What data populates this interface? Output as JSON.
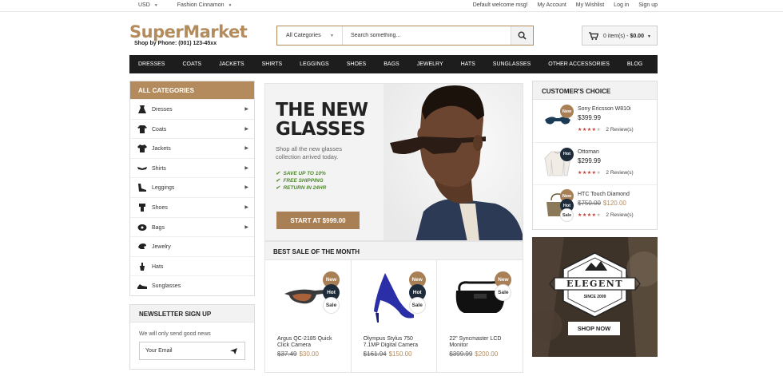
{
  "topbar": {
    "currency": "USD",
    "theme": "Fashion Cinnamon",
    "welcome": "Default welcome msg!",
    "links": [
      "My Account",
      "My Wishlist",
      "Log in",
      "Sign up"
    ]
  },
  "header": {
    "logo": "SuperMarket",
    "phone": "Shop by Phone: (001) 123-45xx",
    "search_category": "All Categories",
    "search_placeholder": "Search something...",
    "cart_items": "0 item(s) - ",
    "cart_total": "$0.00"
  },
  "nav": [
    "DRESSES",
    "COATS",
    "JACKETS",
    "SHIRTS",
    "LEGGINGS",
    "SHOES",
    "BAGS",
    "JEWELRY",
    "HATS",
    "SUNGLASSES",
    "OTHER ACCESSORIES",
    "BLOG"
  ],
  "categories": {
    "title": "ALL CATEGORIES",
    "items": [
      {
        "label": "Dresses",
        "icon": "dress-icon",
        "arrow": true
      },
      {
        "label": "Coats",
        "icon": "coat-icon",
        "arrow": true
      },
      {
        "label": "Jackets",
        "icon": "jacket-icon",
        "arrow": true
      },
      {
        "label": "Shirts",
        "icon": "shirt-icon",
        "arrow": true
      },
      {
        "label": "Leggings",
        "icon": "leggings-icon",
        "arrow": true
      },
      {
        "label": "Shoes",
        "icon": "shoe-icon",
        "arrow": true
      },
      {
        "label": "Bags",
        "icon": "bag-icon",
        "arrow": true
      },
      {
        "label": "Jewelry",
        "icon": "jewelry-icon",
        "arrow": false
      },
      {
        "label": "Hats",
        "icon": "hat-icon",
        "arrow": false
      },
      {
        "label": "Sunglasses",
        "icon": "sunglasses-icon",
        "arrow": false
      }
    ]
  },
  "newsletter": {
    "title": "NEWSLETTER SIGN UP",
    "subtitle": "We will only send good news",
    "placeholder": "Your Email"
  },
  "hero": {
    "title_line1": "THE NEW",
    "title_line2": "GLASSES",
    "description": "Shop all the new glasses collection arrived today.",
    "features": [
      "SAVE UP TO 10%",
      "FREE SHIPPING",
      "RETURN IN 24HR"
    ],
    "cta": "START AT $999.00"
  },
  "best_sale": {
    "title": "BEST SALE OF THE MONTH",
    "products": [
      {
        "name": "Argus QC-2185 Quick Click Camera",
        "old_price": "$37.49",
        "price": "$30.00",
        "badges": [
          "New",
          "Hot",
          "Sale"
        ]
      },
      {
        "name": "Olympus Stylus 750 7.1MP Digital Camera",
        "old_price": "$161.94",
        "price": "$150.00",
        "badges": [
          "New",
          "Hot",
          "Sale"
        ]
      },
      {
        "name": "22\" Syncmaster LCD Monitor",
        "old_price": "$399.99",
        "price": "$200.00",
        "badges": [
          "New",
          "Sale"
        ]
      }
    ]
  },
  "customers_choice": {
    "title": "CUSTOMER'S CHOICE",
    "items": [
      {
        "name": "Sony Ericsson W810i",
        "price": "$399.99",
        "old_price": "",
        "rating": 4,
        "reviews": "2 Review(s)",
        "badges": [
          "New"
        ]
      },
      {
        "name": "Ottoman",
        "price": "$299.99",
        "old_price": "",
        "rating": 4,
        "reviews": "2 Review(s)",
        "badges": [
          "Hot"
        ]
      },
      {
        "name": "HTC Touch Diamond",
        "price": "$120.00",
        "old_price": "$750.00",
        "rating": 4,
        "reviews": "2 Review(s)",
        "badges": [
          "New",
          "Hot",
          "Sale"
        ]
      }
    ]
  },
  "promo": {
    "brand": "ELEGENT",
    "since": "SINCE 2009",
    "cta": "SHOP NOW"
  },
  "colors": {
    "accent": "#b38b5d",
    "nav_bg": "#1d1d1d",
    "hot_badge": "#1d2b3a",
    "feature_green": "#4d8a2a"
  }
}
